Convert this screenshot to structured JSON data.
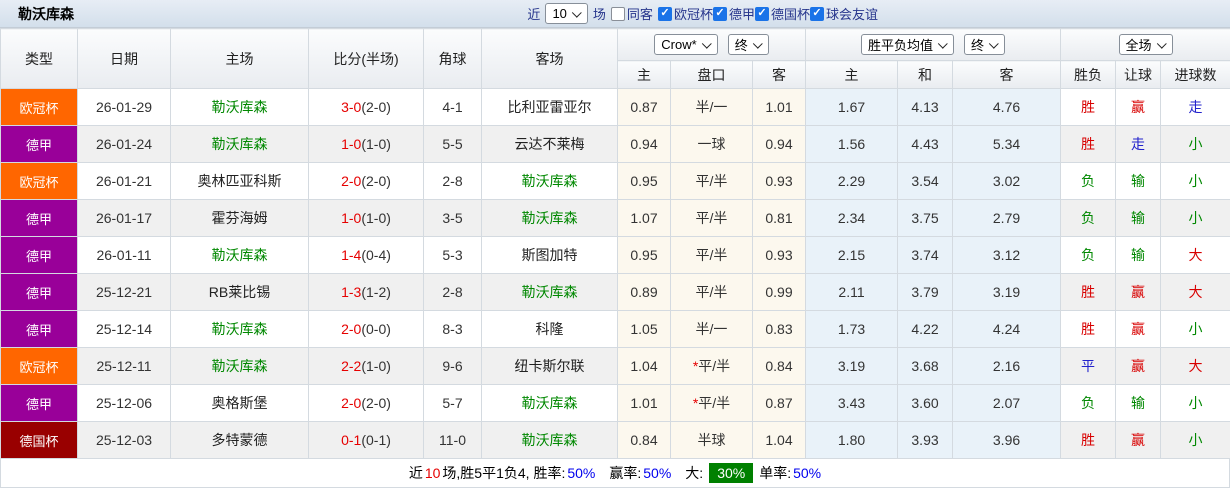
{
  "colors": {
    "league": {
      "欧冠杯": "#ff6600",
      "德甲": "#990099",
      "德国杯": "#990000"
    },
    "accent_red": "#e60000",
    "accent_green": "#008800",
    "accent_blue": "#2222cc",
    "badge_green": "#008000"
  },
  "topbar": {
    "title": "勒沃库森",
    "near_label": "近",
    "matches_value": "10",
    "matches_suffix": "场",
    "same_opponent_label": "同客",
    "same_opponent_checked": false,
    "filters": [
      {
        "label": "欧冠杯",
        "checked": true
      },
      {
        "label": "德甲",
        "checked": true
      },
      {
        "label": "德国杯",
        "checked": true
      },
      {
        "label": "球会友谊",
        "checked": true
      }
    ]
  },
  "table": {
    "left_headers": [
      "类型",
      "日期",
      "主场",
      "比分(半场)",
      "角球",
      "客场"
    ],
    "odds_group": {
      "bookmaker": "Crow*",
      "stage": "终",
      "sub_headers": [
        "主",
        "盘口",
        "客"
      ]
    },
    "avg_group": {
      "name": "胜平负均值",
      "stage": "终",
      "sub_headers": [
        "主",
        "和",
        "客"
      ]
    },
    "result_group": {
      "scope": "全场",
      "sub_headers": [
        "胜负",
        "让球",
        "进球数"
      ]
    },
    "rows": [
      {
        "league": "欧冠杯",
        "date": "26-01-29",
        "home": "勒沃库森",
        "home_highlight": true,
        "score": "3-0",
        "half": "(2-0)",
        "corner": "4-1",
        "away": "比利亚雷亚尔",
        "away_highlight": false,
        "home_odds": "0.87",
        "handicap": "半/一",
        "handicap_star": false,
        "away_odds": "1.01",
        "avg_home": "1.67",
        "avg_draw": "4.13",
        "avg_away": "4.76",
        "result": {
          "text": "胜",
          "color": "red"
        },
        "handicap_result": {
          "text": "赢",
          "color": "red"
        },
        "goals_result": {
          "text": "走",
          "color": "blue"
        }
      },
      {
        "league": "德甲",
        "date": "26-01-24",
        "home": "勒沃库森",
        "home_highlight": true,
        "score": "1-0",
        "half": "(1-0)",
        "corner": "5-5",
        "away": "云达不莱梅",
        "away_highlight": false,
        "home_odds": "0.94",
        "handicap": "一球",
        "handicap_star": false,
        "away_odds": "0.94",
        "avg_home": "1.56",
        "avg_draw": "4.43",
        "avg_away": "5.34",
        "result": {
          "text": "胜",
          "color": "red"
        },
        "handicap_result": {
          "text": "走",
          "color": "blue"
        },
        "goals_result": {
          "text": "小",
          "color": "green"
        }
      },
      {
        "league": "欧冠杯",
        "date": "26-01-21",
        "home": "奥林匹亚科斯",
        "home_highlight": false,
        "score": "2-0",
        "half": "(2-0)",
        "corner": "2-8",
        "away": "勒沃库森",
        "away_highlight": true,
        "home_odds": "0.95",
        "handicap": "平/半",
        "handicap_star": false,
        "away_odds": "0.93",
        "avg_home": "2.29",
        "avg_draw": "3.54",
        "avg_away": "3.02",
        "result": {
          "text": "负",
          "color": "green"
        },
        "handicap_result": {
          "text": "输",
          "color": "green"
        },
        "goals_result": {
          "text": "小",
          "color": "green"
        }
      },
      {
        "league": "德甲",
        "date": "26-01-17",
        "home": "霍芬海姆",
        "home_highlight": false,
        "score": "1-0",
        "half": "(1-0)",
        "corner": "3-5",
        "away": "勒沃库森",
        "away_highlight": true,
        "home_odds": "1.07",
        "handicap": "平/半",
        "handicap_star": false,
        "away_odds": "0.81",
        "avg_home": "2.34",
        "avg_draw": "3.75",
        "avg_away": "2.79",
        "result": {
          "text": "负",
          "color": "green"
        },
        "handicap_result": {
          "text": "输",
          "color": "green"
        },
        "goals_result": {
          "text": "小",
          "color": "green"
        }
      },
      {
        "league": "德甲",
        "date": "26-01-11",
        "home": "勒沃库森",
        "home_highlight": true,
        "score": "1-4",
        "half": "(0-4)",
        "corner": "5-3",
        "away": "斯图加特",
        "away_highlight": false,
        "home_odds": "0.95",
        "handicap": "平/半",
        "handicap_star": false,
        "away_odds": "0.93",
        "avg_home": "2.15",
        "avg_draw": "3.74",
        "avg_away": "3.12",
        "result": {
          "text": "负",
          "color": "green"
        },
        "handicap_result": {
          "text": "输",
          "color": "green"
        },
        "goals_result": {
          "text": "大",
          "color": "red"
        }
      },
      {
        "league": "德甲",
        "date": "25-12-21",
        "home": "RB莱比锡",
        "home_highlight": false,
        "score": "1-3",
        "half": "(1-2)",
        "corner": "2-8",
        "away": "勒沃库森",
        "away_highlight": true,
        "home_odds": "0.89",
        "handicap": "平/半",
        "handicap_star": false,
        "away_odds": "0.99",
        "avg_home": "2.11",
        "avg_draw": "3.79",
        "avg_away": "3.19",
        "result": {
          "text": "胜",
          "color": "red"
        },
        "handicap_result": {
          "text": "赢",
          "color": "red"
        },
        "goals_result": {
          "text": "大",
          "color": "red"
        }
      },
      {
        "league": "德甲",
        "date": "25-12-14",
        "home": "勒沃库森",
        "home_highlight": true,
        "score": "2-0",
        "half": "(0-0)",
        "corner": "8-3",
        "away": "科隆",
        "away_highlight": false,
        "home_odds": "1.05",
        "handicap": "半/一",
        "handicap_star": false,
        "away_odds": "0.83",
        "avg_home": "1.73",
        "avg_draw": "4.22",
        "avg_away": "4.24",
        "result": {
          "text": "胜",
          "color": "red"
        },
        "handicap_result": {
          "text": "赢",
          "color": "red"
        },
        "goals_result": {
          "text": "小",
          "color": "green"
        }
      },
      {
        "league": "欧冠杯",
        "date": "25-12-11",
        "home": "勒沃库森",
        "home_highlight": true,
        "score": "2-2",
        "half": "(1-0)",
        "corner": "9-6",
        "away": "纽卡斯尔联",
        "away_highlight": false,
        "home_odds": "1.04",
        "handicap": "平/半",
        "handicap_star": true,
        "away_odds": "0.84",
        "avg_home": "3.19",
        "avg_draw": "3.68",
        "avg_away": "2.16",
        "result": {
          "text": "平",
          "color": "blue"
        },
        "handicap_result": {
          "text": "赢",
          "color": "red"
        },
        "goals_result": {
          "text": "大",
          "color": "red"
        }
      },
      {
        "league": "德甲",
        "date": "25-12-06",
        "home": "奥格斯堡",
        "home_highlight": false,
        "score": "2-0",
        "half": "(2-0)",
        "corner": "5-7",
        "away": "勒沃库森",
        "away_highlight": true,
        "home_odds": "1.01",
        "handicap": "平/半",
        "handicap_star": true,
        "away_odds": "0.87",
        "avg_home": "3.43",
        "avg_draw": "3.60",
        "avg_away": "2.07",
        "result": {
          "text": "负",
          "color": "green"
        },
        "handicap_result": {
          "text": "输",
          "color": "green"
        },
        "goals_result": {
          "text": "小",
          "color": "green"
        }
      },
      {
        "league": "德国杯",
        "date": "25-12-03",
        "home": "多特蒙德",
        "home_highlight": false,
        "score": "0-1",
        "half": "(0-1)",
        "corner": "11-0",
        "away": "勒沃库森",
        "away_highlight": true,
        "home_odds": "0.84",
        "handicap": "半球",
        "handicap_star": false,
        "away_odds": "1.04",
        "avg_home": "1.80",
        "avg_draw": "3.93",
        "avg_away": "3.96",
        "result": {
          "text": "胜",
          "color": "red"
        },
        "handicap_result": {
          "text": "赢",
          "color": "red"
        },
        "goals_result": {
          "text": "小",
          "color": "green"
        }
      }
    ]
  },
  "footer": {
    "text1": "近",
    "count": "10",
    "text2": "场,胜5平1负4, 胜率:",
    "rate1": "50%",
    "text3": "赢率:",
    "rate2": "50%",
    "text4": "大:",
    "big_rate": "30%",
    "text5": "单率:",
    "rate3": "50%"
  }
}
